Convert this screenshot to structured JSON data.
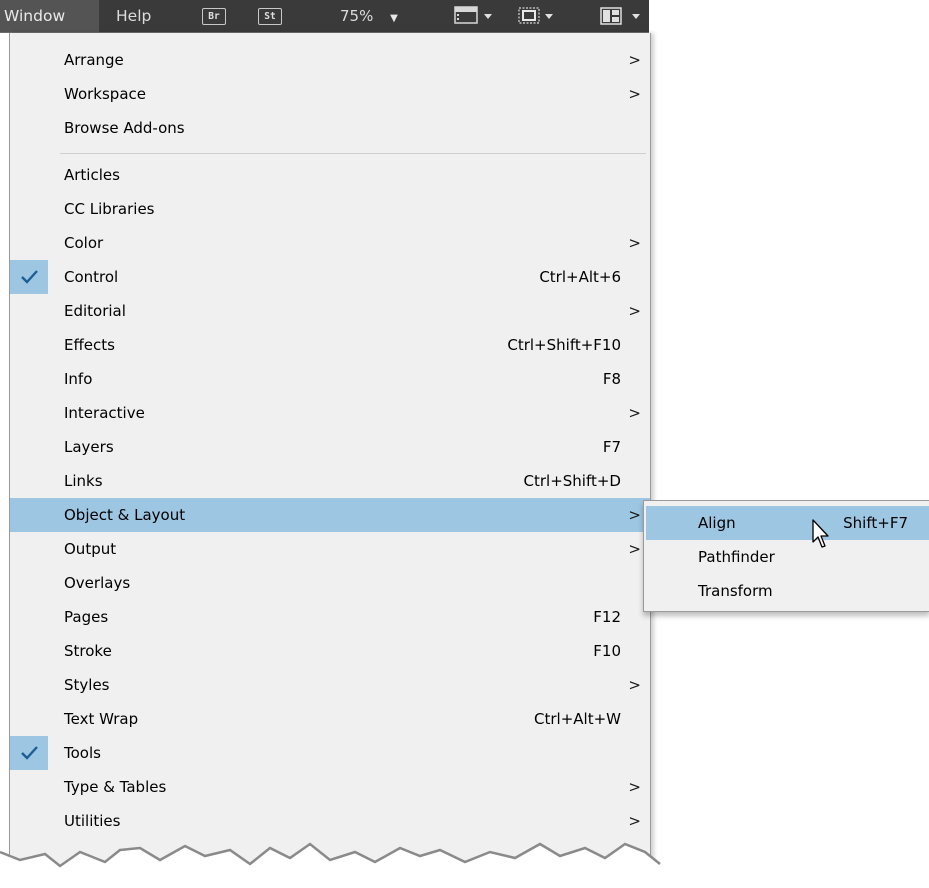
{
  "menubar": {
    "items": [
      {
        "label": "Window"
      },
      {
        "label": "Help"
      }
    ],
    "badges": [
      {
        "label": "Br"
      },
      {
        "label": "St"
      }
    ],
    "zoom": "75%"
  },
  "menu": {
    "items": [
      {
        "label": "Arrange",
        "shortcut": "",
        "submenu": true
      },
      {
        "label": "Workspace",
        "shortcut": "",
        "submenu": true
      },
      {
        "label": "Browse Add-ons",
        "shortcut": "",
        "submenu": false
      },
      {
        "label": "Articles",
        "shortcut": "",
        "submenu": false
      },
      {
        "label": "CC Libraries",
        "shortcut": "",
        "submenu": false
      },
      {
        "label": "Color",
        "shortcut": "",
        "submenu": true
      },
      {
        "label": "Control",
        "shortcut": "Ctrl+Alt+6",
        "checked": true
      },
      {
        "label": "Editorial",
        "shortcut": "",
        "submenu": true
      },
      {
        "label": "Effects",
        "shortcut": "Ctrl+Shift+F10"
      },
      {
        "label": "Info",
        "shortcut": "F8"
      },
      {
        "label": "Interactive",
        "shortcut": "",
        "submenu": true
      },
      {
        "label": "Layers",
        "shortcut": "F7"
      },
      {
        "label": "Links",
        "shortcut": "Ctrl+Shift+D"
      },
      {
        "label": "Object & Layout",
        "shortcut": "",
        "submenu": true,
        "selected": true
      },
      {
        "label": "Output",
        "shortcut": "",
        "submenu": true
      },
      {
        "label": "Overlays",
        "shortcut": ""
      },
      {
        "label": "Pages",
        "shortcut": "F12"
      },
      {
        "label": "Stroke",
        "shortcut": "F10"
      },
      {
        "label": "Styles",
        "shortcut": "",
        "submenu": true
      },
      {
        "label": "Text Wrap",
        "shortcut": "Ctrl+Alt+W"
      },
      {
        "label": "Tools",
        "shortcut": "",
        "checked": true
      },
      {
        "label": "Type & Tables",
        "shortcut": "",
        "submenu": true
      },
      {
        "label": "Utilities",
        "shortcut": "",
        "submenu": true
      }
    ],
    "submenu_glyph": ">",
    "check_glyph": "✓"
  },
  "submenu": {
    "items": [
      {
        "label": "Align",
        "shortcut": "Shift+F7",
        "selected": true
      },
      {
        "label": "Pathfinder",
        "shortcut": ""
      },
      {
        "label": "Transform",
        "shortcut": ""
      }
    ]
  },
  "colors": {
    "menubar_bg": "#3a3a3a",
    "menu_bg": "#f0f0f0",
    "highlight": "#9cc6e2",
    "check": "#1c5f95"
  },
  "icons": [
    "br-badge",
    "st-badge",
    "chevron-down-icon",
    "screen-mode-icon",
    "view-options-icon",
    "arrange-documents-icon",
    "checkmark-icon",
    "submenu-arrow-icon",
    "mouse-pointer-icon"
  ]
}
